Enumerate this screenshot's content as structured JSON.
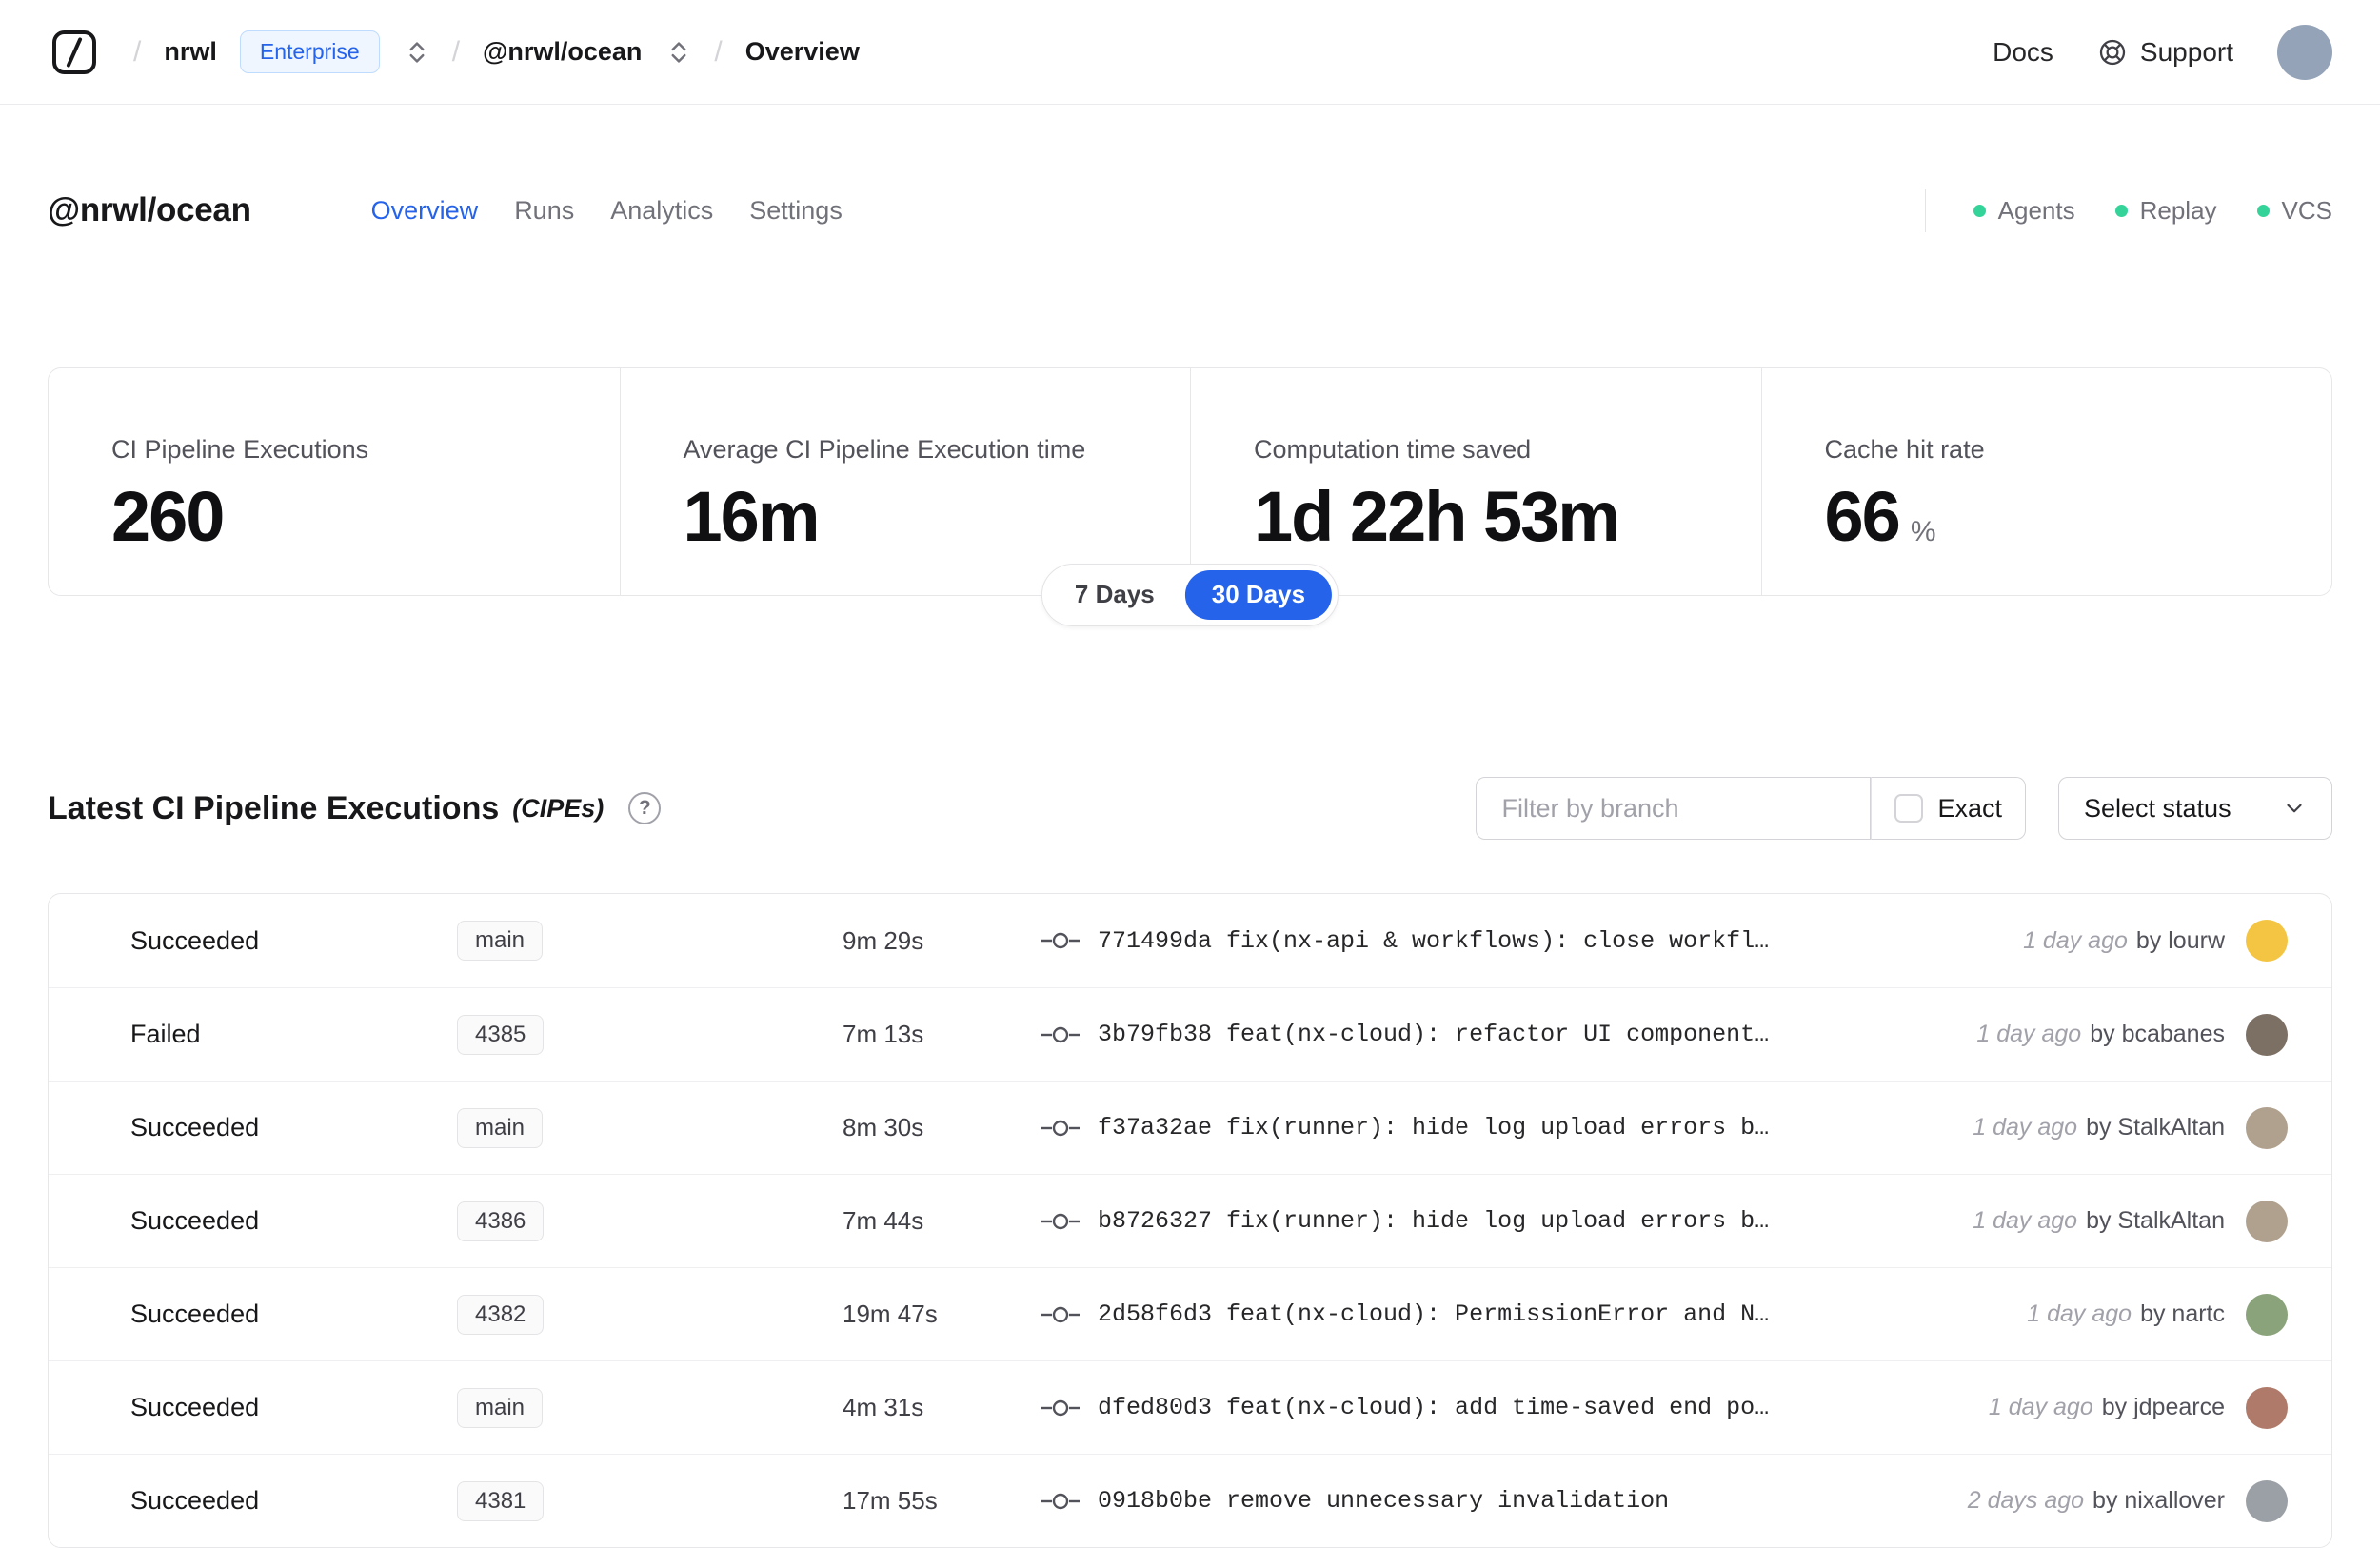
{
  "navbar": {
    "breadcrumb": {
      "org": "nrwl",
      "org_badge": "Enterprise",
      "workspace": "@nrwl/ocean",
      "page": "Overview"
    },
    "links": {
      "docs": "Docs",
      "support": "Support"
    }
  },
  "header": {
    "title": "@nrwl/ocean",
    "tabs": [
      {
        "label": "Overview",
        "active": true
      },
      {
        "label": "Runs",
        "active": false
      },
      {
        "label": "Analytics",
        "active": false
      },
      {
        "label": "Settings",
        "active": false
      }
    ],
    "indicators": [
      "Agents",
      "Replay",
      "VCS"
    ]
  },
  "stats": {
    "cards": [
      {
        "label": "CI Pipeline Executions",
        "value": "260"
      },
      {
        "label": "Average CI Pipeline Execution time",
        "value": "16m"
      },
      {
        "label": "Computation time saved",
        "value": "1d 22h 53m"
      },
      {
        "label": "Cache hit rate",
        "value": "66",
        "suffix": "%"
      }
    ],
    "range_toggle": {
      "options": [
        "7 Days",
        "30 Days"
      ],
      "selected": "30 Days"
    }
  },
  "cipes": {
    "title": "Latest CI Pipeline Executions",
    "subtitle": "(CIPEs)",
    "help": "?",
    "filter_placeholder": "Filter by branch",
    "exact_label": "Exact",
    "status_select": "Select status",
    "rows": [
      {
        "status": "Succeeded",
        "dot_color": "#22c55e",
        "branch": "main",
        "duration": "9m 29s",
        "commit": "771499da fix(nx-api & workflows): close workfl…",
        "time": "1 day ago",
        "author": "by lourw",
        "avatar_color": "#f4c542"
      },
      {
        "status": "Failed",
        "dot_color": "#ef4444",
        "branch": "4385",
        "duration": "7m 13s",
        "commit": "3b79fb38 feat(nx-cloud): refactor UI component…",
        "time": "1 day ago",
        "author": "by bcabanes",
        "avatar_color": "#7c6f64"
      },
      {
        "status": "Succeeded",
        "dot_color": "#22c55e",
        "branch": "main",
        "duration": "8m 30s",
        "commit": "f37a32ae fix(runner): hide log upload errors b…",
        "time": "1 day ago",
        "author": "by StalkAltan",
        "avatar_color": "#b0a08e"
      },
      {
        "status": "Succeeded",
        "dot_color": "#22c55e",
        "branch": "4386",
        "duration": "7m 44s",
        "commit": "b8726327 fix(runner): hide log upload errors b…",
        "time": "1 day ago",
        "author": "by StalkAltan",
        "avatar_color": "#b0a08e"
      },
      {
        "status": "Succeeded",
        "dot_color": "#22c55e",
        "branch": "4382",
        "duration": "19m 47s",
        "commit": "2d58f6d3 feat(nx-cloud): PermissionError and N…",
        "time": "1 day ago",
        "author": "by nartc",
        "avatar_color": "#8aa37b"
      },
      {
        "status": "Succeeded",
        "dot_color": "#22c55e",
        "branch": "main",
        "duration": "4m 31s",
        "commit": "dfed80d3 feat(nx-cloud): add time-saved end po…",
        "time": "1 day ago",
        "author": "by jdpearce",
        "avatar_color": "#b07a6a"
      },
      {
        "status": "Succeeded",
        "dot_color": "#22c55e",
        "branch": "4381",
        "duration": "17m 55s",
        "commit": "0918b0be remove unnecessary invalidation",
        "time": "2 days ago",
        "author": "by nixallover",
        "avatar_color": "#9aa0a6"
      }
    ]
  },
  "colors": {
    "accent_blue": "#2563eb",
    "indicator_green": "#34d399",
    "success_green": "#22c55e",
    "failed_red": "#ef4444"
  }
}
